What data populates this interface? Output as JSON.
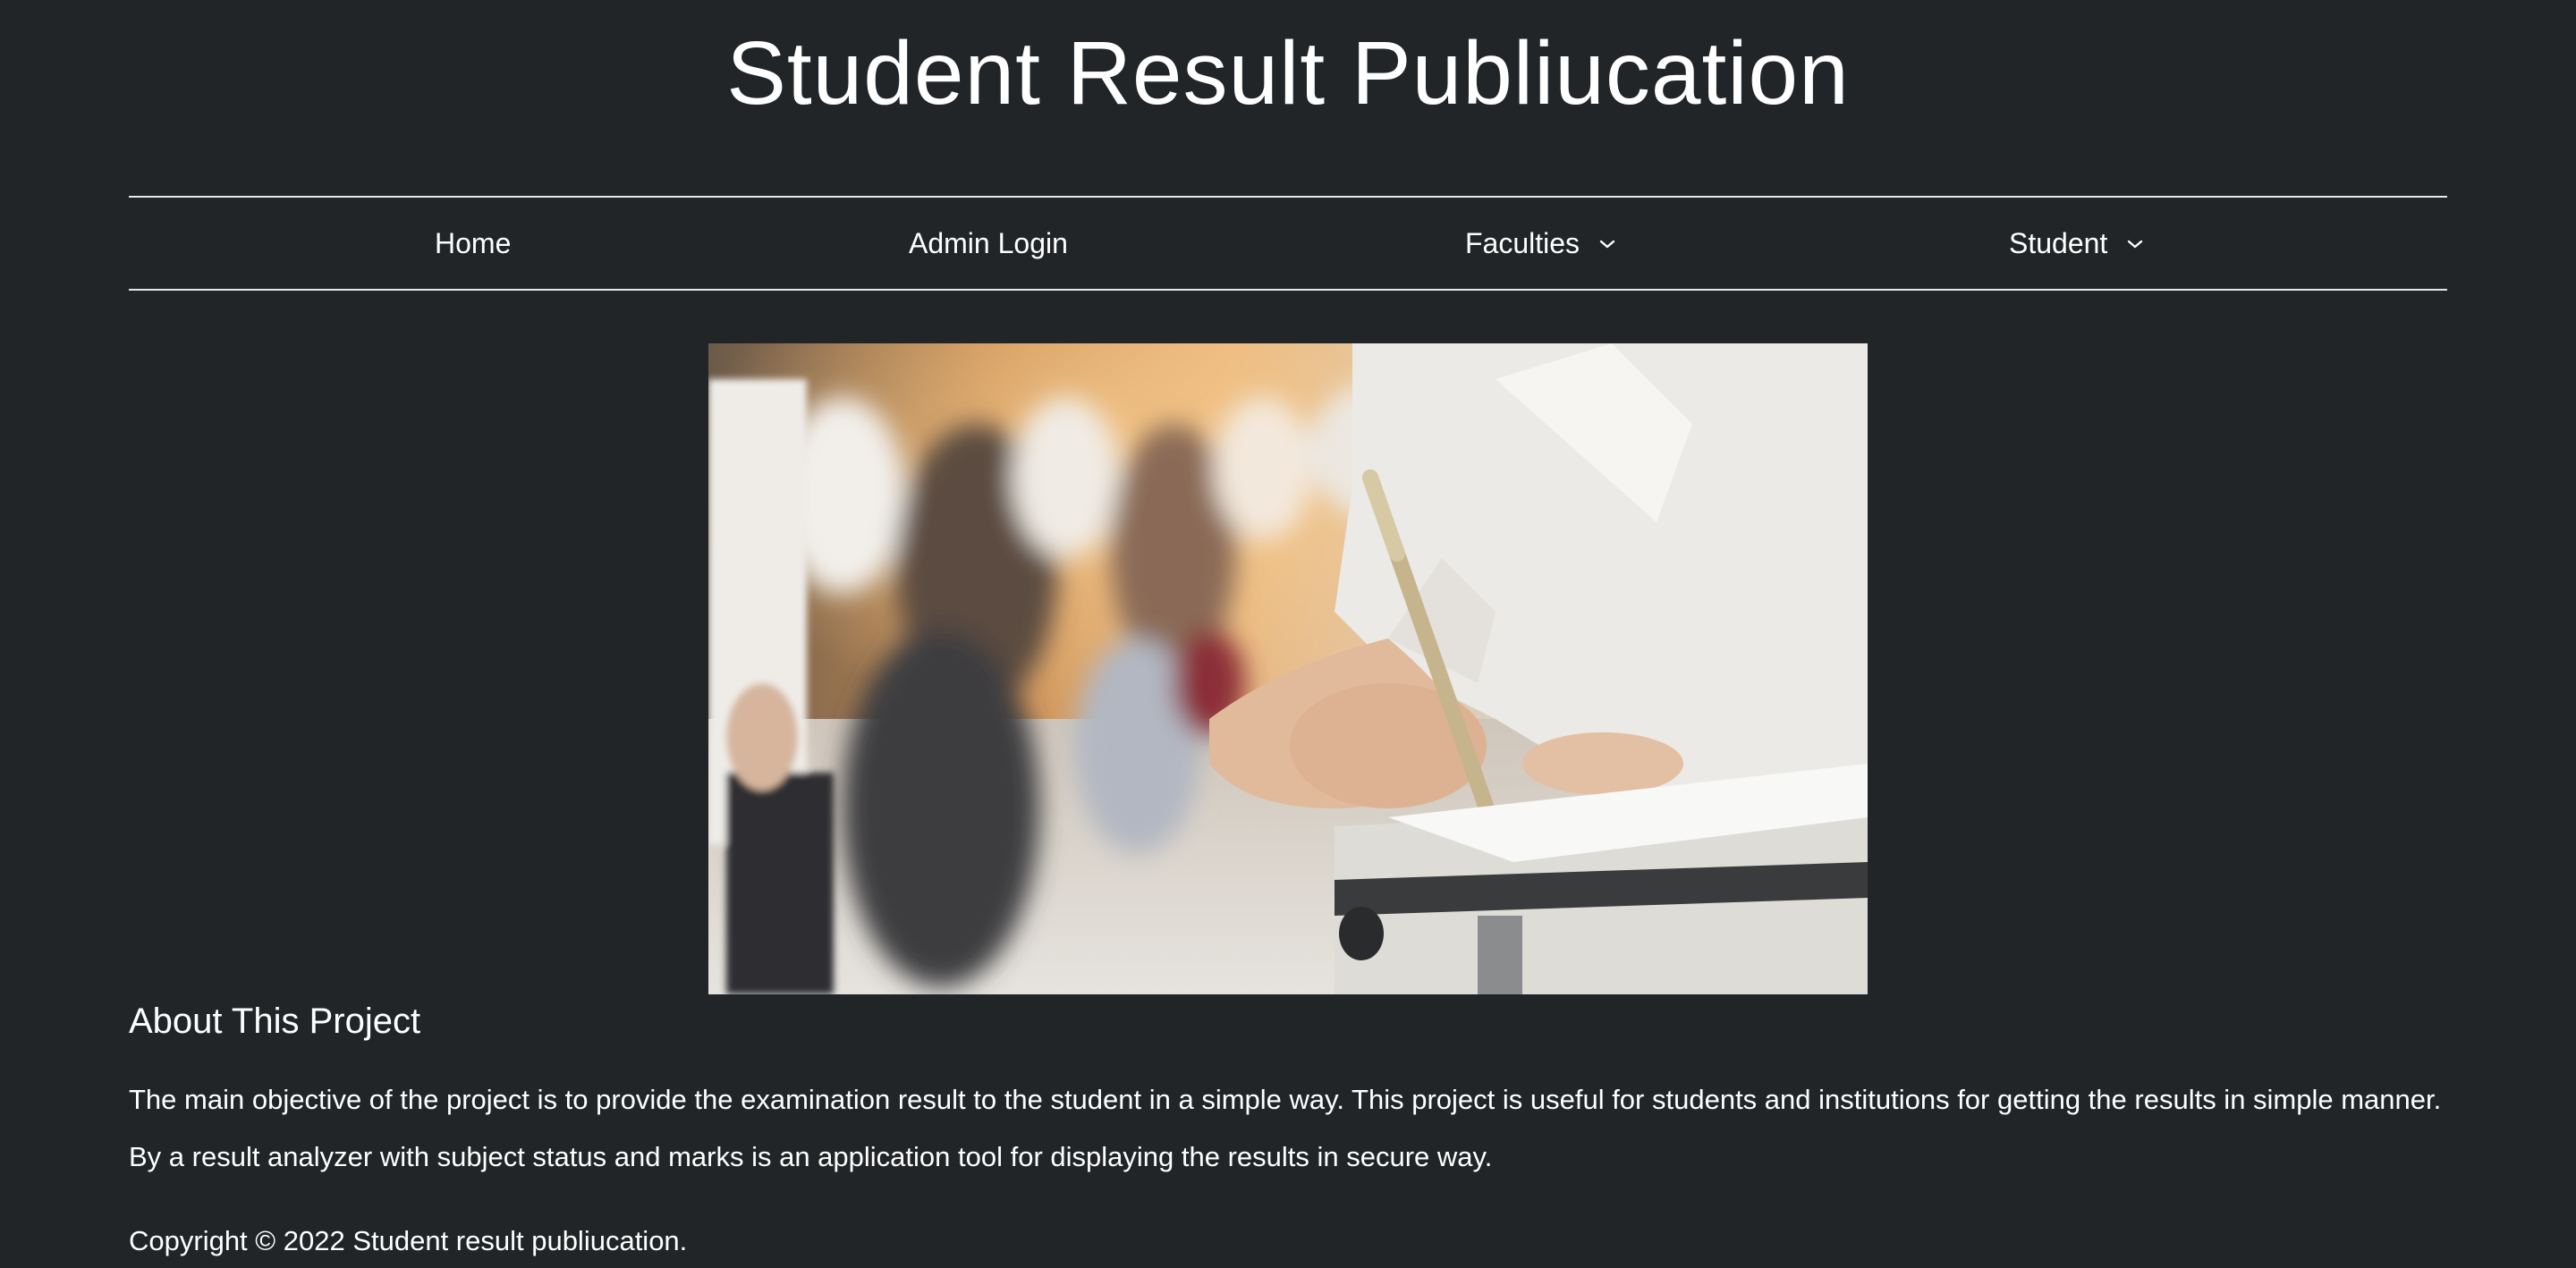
{
  "header": {
    "title": "Student Result Publiucation"
  },
  "nav": {
    "items": [
      {
        "label": "Home"
      },
      {
        "label": "Admin Login"
      },
      {
        "label": "Faculties"
      },
      {
        "label": "Student"
      }
    ]
  },
  "hero": {
    "icon": "exam-photo"
  },
  "about": {
    "heading": "About This Project",
    "text": "The main objective of the project is to provide the examination result to the student in a simple way. This project is useful for students and institutions for getting the results in simple manner. By a result analyzer with subject status and marks is an application tool for displaying the results in secure way."
  },
  "footer": {
    "copyright": "Copyright © 2022 Student result publiucation."
  },
  "colors": {
    "background": "#212528",
    "text": "#ffffff",
    "divider": "#e8e8e8"
  }
}
